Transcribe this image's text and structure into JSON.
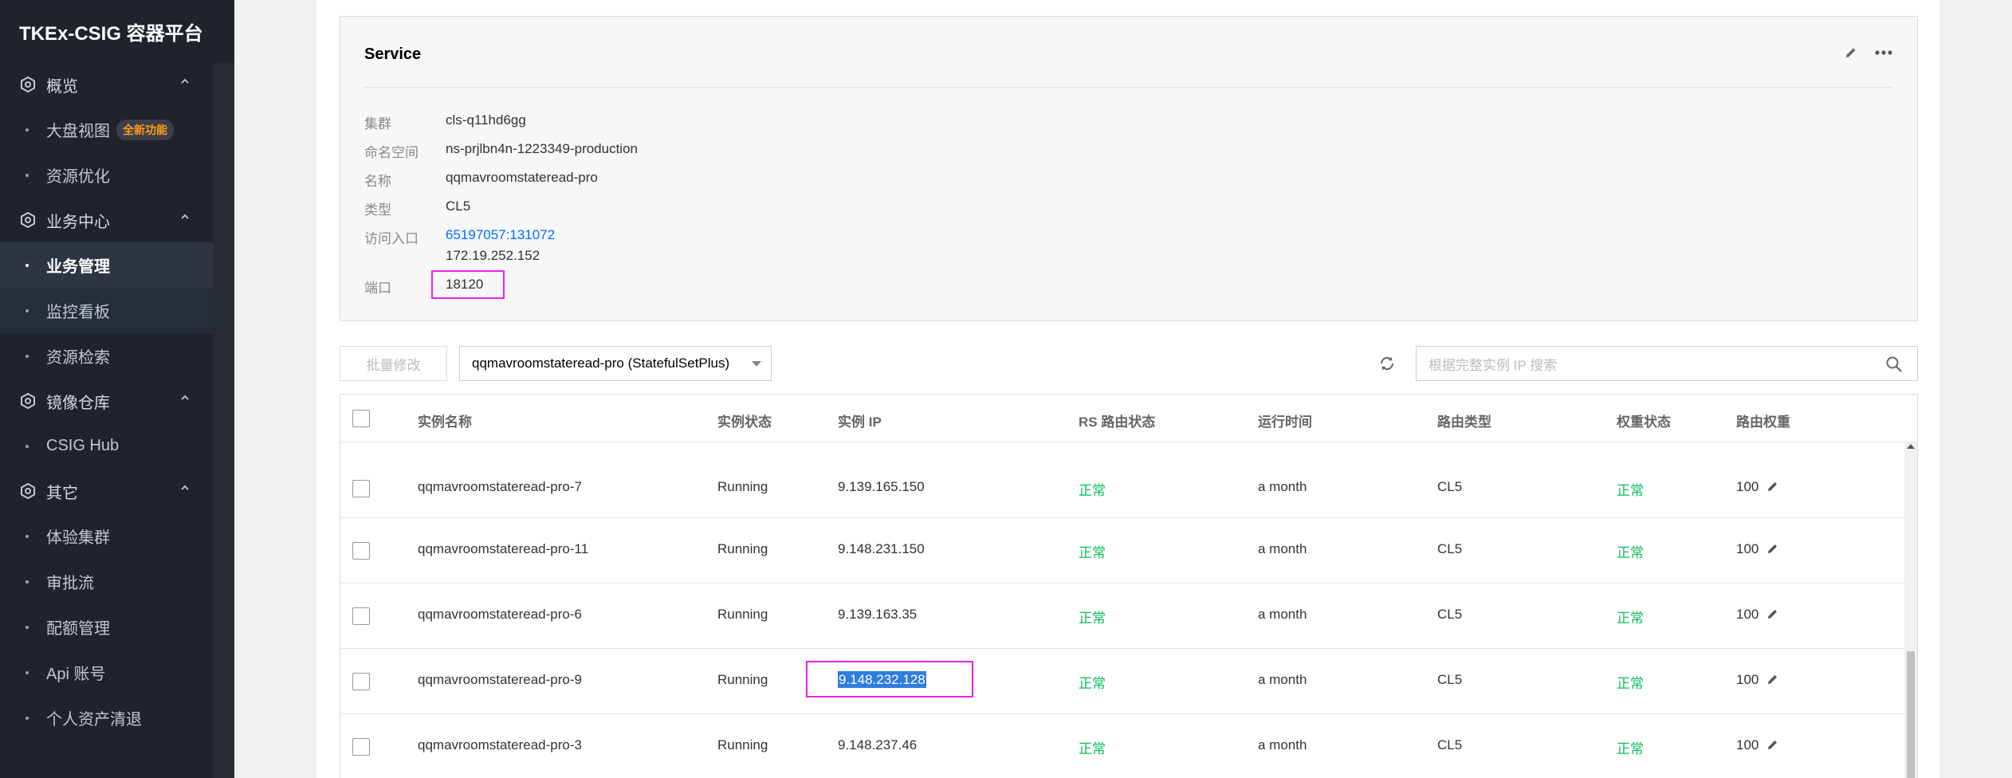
{
  "app": {
    "title": "TKEx-CSIG 容器平台"
  },
  "sidebar": {
    "groups": [
      {
        "label": "概览",
        "items": [
          {
            "label": "大盘视图",
            "badge": "全新功能"
          },
          {
            "label": "资源优化"
          }
        ]
      },
      {
        "label": "业务中心",
        "items": [
          {
            "label": "业务管理"
          },
          {
            "label": "监控看板"
          },
          {
            "label": "资源检索"
          }
        ]
      },
      {
        "label": "镜像仓库",
        "items": [
          {
            "label": "CSIG Hub"
          }
        ]
      },
      {
        "label": "其它",
        "items": [
          {
            "label": "体验集群"
          },
          {
            "label": "审批流"
          },
          {
            "label": "配额管理"
          },
          {
            "label": "Api 账号"
          },
          {
            "label": "个人资产清退"
          }
        ]
      }
    ]
  },
  "service": {
    "title": "Service",
    "fields": {
      "cluster": {
        "label": "集群",
        "value": "cls-q11hd6gg"
      },
      "namespace": {
        "label": "命名空间",
        "value": "ns-prjlbn4n-1223349-production"
      },
      "name": {
        "label": "名称",
        "value": "qqmavroomstateread-pro"
      },
      "type": {
        "label": "类型",
        "value": "CL5"
      },
      "access": {
        "label": "访问入口",
        "link": "65197057:131072",
        "ip": "172.19.252.152"
      },
      "port": {
        "label": "端口",
        "value": "18120"
      }
    }
  },
  "toolbar": {
    "batch_label": "批量修改",
    "select_value": "qqmavroomstateread-pro (StatefulSetPlus)",
    "search_placeholder": "根据完整实例 IP 搜索"
  },
  "table": {
    "headers": {
      "name": "实例名称",
      "status": "实例状态",
      "ip": "实例 IP",
      "rs": "RS 路由状态",
      "uptime": "运行时间",
      "route_type": "路由类型",
      "weight_status": "权重状态",
      "weight": "路由权重"
    },
    "rows": [
      {
        "name": "qqmavroomstateread-pro-7",
        "status": "Running",
        "ip": "9.139.165.150",
        "rs": "正常",
        "uptime": "a month",
        "route_type": "CL5",
        "weight_status": "正常",
        "weight": "100"
      },
      {
        "name": "qqmavroomstateread-pro-11",
        "status": "Running",
        "ip": "9.148.231.150",
        "rs": "正常",
        "uptime": "a month",
        "route_type": "CL5",
        "weight_status": "正常",
        "weight": "100"
      },
      {
        "name": "qqmavroomstateread-pro-6",
        "status": "Running",
        "ip": "9.139.163.35",
        "rs": "正常",
        "uptime": "a month",
        "route_type": "CL5",
        "weight_status": "正常",
        "weight": "100"
      },
      {
        "name": "qqmavroomstateread-pro-9",
        "status": "Running",
        "ip": "9.148.232.128",
        "rs": "正常",
        "uptime": "a month",
        "route_type": "CL5",
        "weight_status": "正常",
        "weight": "100"
      },
      {
        "name": "qqmavroomstateread-pro-3",
        "status": "Running",
        "ip": "9.148.237.46",
        "rs": "正常",
        "uptime": "a month",
        "route_type": "CL5",
        "weight_status": "正常",
        "weight": "100"
      }
    ]
  },
  "colors": {
    "sidebar_bg": "#1f232c",
    "accent": "#006eff",
    "ok_green": "#0abf5b",
    "highlight_box": "#ee21ee",
    "badge_text": "#ff9c19"
  }
}
